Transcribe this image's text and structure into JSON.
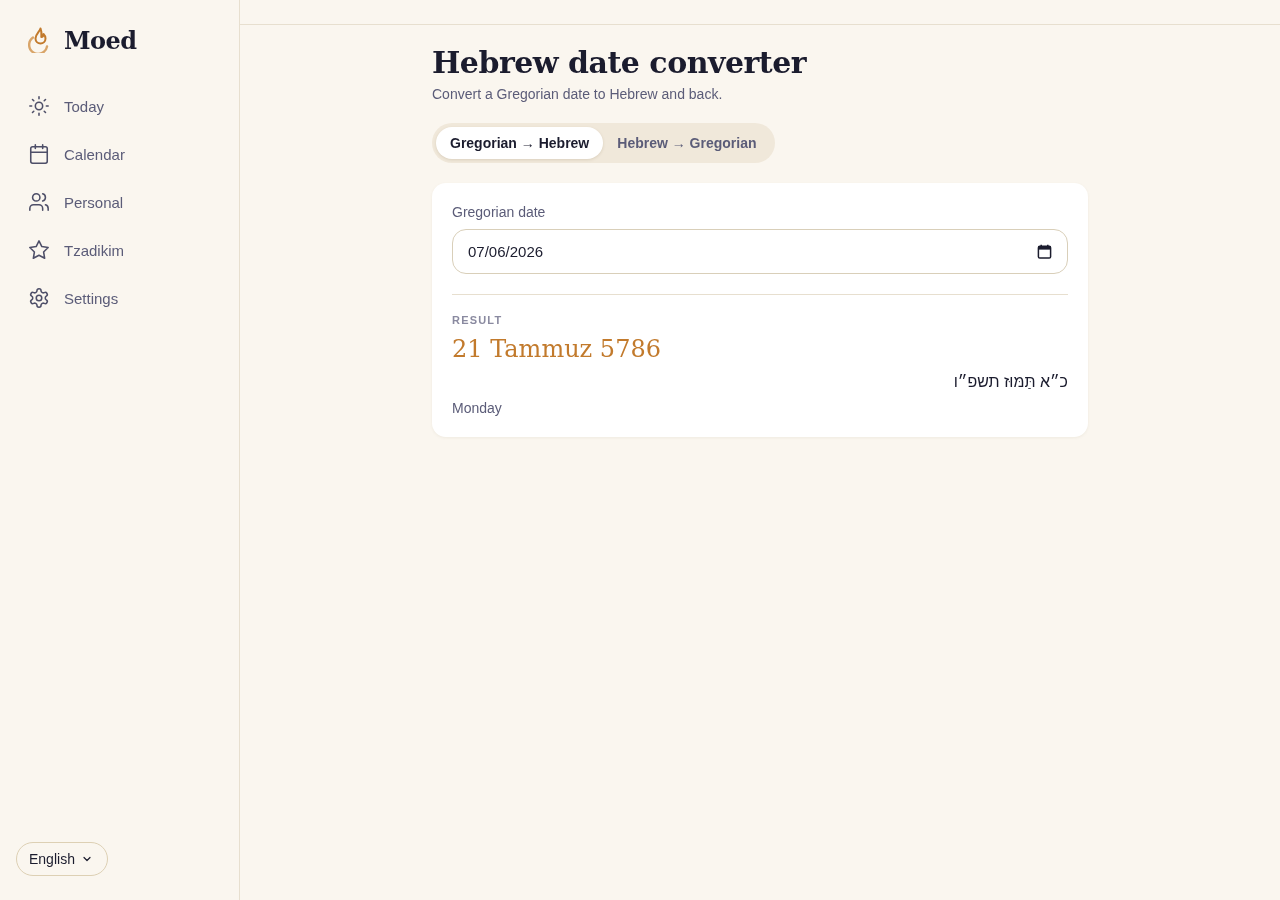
{
  "sidebar": {
    "brand": "Moed",
    "items": [
      {
        "label": "Today",
        "kind": "sun",
        "selected": false
      },
      {
        "label": "Calendar",
        "kind": "calendar",
        "selected": false
      },
      {
        "label": "Personal",
        "kind": "people",
        "selected": false
      },
      {
        "label": "Tzadikim",
        "kind": "star",
        "selected": false
      },
      {
        "label": "Settings",
        "kind": "gear",
        "selected": false
      }
    ],
    "language": "English"
  },
  "page": {
    "title": "Hebrew date converter",
    "subtitle": "Convert a Gregorian date to Hebrew and back."
  },
  "tabs": [
    {
      "label": "Gregorian → Hebrew",
      "selected": true
    },
    {
      "label": "Hebrew → Gregorian",
      "selected": false
    }
  ],
  "form": {
    "label": "Gregorian date",
    "value": "07/06/2026"
  },
  "result": {
    "heading": "RESULT",
    "date": "21 Tammuz 5786",
    "hebrew": "כ״א תַּמּוּז תשפ״ו",
    "weekday": "Monday"
  }
}
